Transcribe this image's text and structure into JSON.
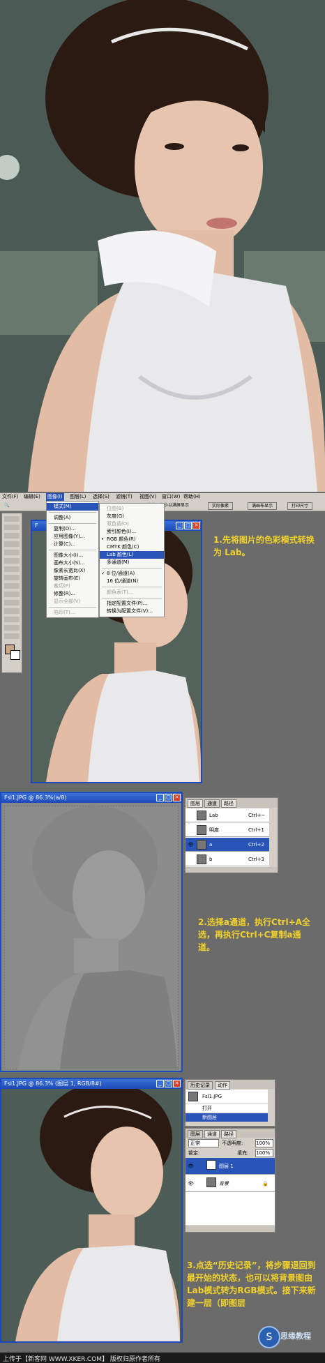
{
  "colors": {
    "gold": "#f2d22a",
    "titlebar": "#1c4ab8",
    "highlight": "#2a55b8",
    "workspace": "#6b6b6b"
  },
  "section1": {
    "caption": ""
  },
  "menubar": {
    "items": [
      "文件(F)",
      "编辑(E)",
      "图像(I)",
      "图层(L)",
      "选择(S)",
      "滤镜(T)",
      "视图(V)",
      "窗口(W)",
      "帮助(H)"
    ],
    "right_buttons": [
      "调整窗口大小以满屏显示",
      "实际像素",
      "满画布显示",
      "打印尺寸"
    ]
  },
  "image_menu": {
    "items": [
      "模式(M)",
      "",
      "调整(A)",
      "",
      "复制(D)...",
      "应用图像(Y)...",
      "计算(C)...",
      "",
      "图像大小(I)...",
      "画布大小(S)...",
      "像素长宽比(X)",
      "旋转画布(E)",
      "裁切(P)",
      "修整(R)...",
      "显示全部(V)",
      "",
      "陷印(T)..."
    ]
  },
  "mode_submenu": {
    "items": [
      "位图(B)",
      "灰度(G)",
      "双色调(D)",
      "索引颜色(I)...",
      "RGB 颜色(R)",
      "CMYK 颜色(C)",
      "Lab 颜色(L)",
      "多通道(M)",
      "",
      "8 位/通道(A)",
      "16 位/通道(N)",
      "",
      "颜色表(T)...",
      "",
      "指定配置文件(P)...",
      "转换为配置文件(V)..."
    ]
  },
  "window1": {
    "title": "F"
  },
  "note1": "1.先将图片的色彩模式转换为 Lab。",
  "window2": {
    "title": "Fsl1.JPG @ 86.3%(a/8)"
  },
  "channels_panel": {
    "tabs": [
      "图层",
      "通道",
      "路径"
    ],
    "rows": [
      {
        "name": "Lab",
        "shortcut": "Ctrl+~"
      },
      {
        "name": "明度",
        "shortcut": "Ctrl+1"
      },
      {
        "name": "a",
        "shortcut": "Ctrl+2"
      },
      {
        "name": "b",
        "shortcut": "Ctrl+3"
      }
    ]
  },
  "note2": "2.选择a通道，执行Ctrl+A全选，再执行Ctrl+C复制a通道。",
  "window3": {
    "title": "Fsl1.JPG @ 86.3% (图层 1, RGB/8#)"
  },
  "history_panel": {
    "tabs": [
      "历史记录",
      "动作"
    ],
    "snapshot": "Fsl1.JPG",
    "steps": [
      "打开",
      "新图层"
    ]
  },
  "layers_panel": {
    "tabs": [
      "图层",
      "通道",
      "路径"
    ],
    "blend_mode": "正常",
    "opacity_label": "不透明度:",
    "opacity": "100%",
    "lock_label": "锁定:",
    "fill_label": "填充:",
    "fill": "100%",
    "layers": [
      "图层 1",
      "背景"
    ]
  },
  "note3": "3.点选“历史记录”，将步骤退回到最开始的状态，也可以将背景图由Lab模式转为RGB模式。接下来新建一层（即图层",
  "footer": "上传于【新客网 WWW.XKER.COM】 版权归原作者所有",
  "watermark": "思缘教程"
}
